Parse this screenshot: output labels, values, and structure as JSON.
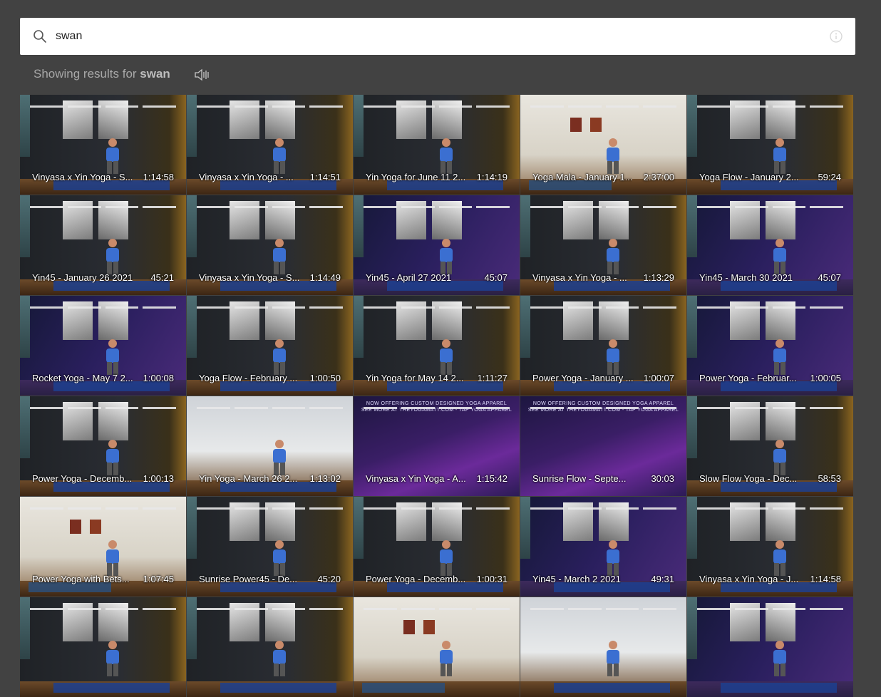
{
  "search": {
    "value": "swan",
    "placeholder": ""
  },
  "results": {
    "prefix": "Showing results for ",
    "query": "swan"
  },
  "icons": {
    "search": "search-icon",
    "info": "info-icon",
    "speaker": "speaker-icon"
  },
  "videos": [
    {
      "title": "Vinyasa x Yin Yoga - S...",
      "duration": "1:14:58",
      "style": "studio"
    },
    {
      "title": "Vinyasa x Yin Yoga - ...",
      "duration": "1:14:51",
      "style": "studio"
    },
    {
      "title": "Yin Yoga for June 11 2...",
      "duration": "1:14:19",
      "style": "studio"
    },
    {
      "title": "Yoga Mala - January 1...",
      "duration": "2:37:00",
      "style": "room"
    },
    {
      "title": "Yoga Flow - January 2...",
      "duration": "59:24",
      "style": "studio"
    },
    {
      "title": "Yin45 - January 26 2021",
      "duration": "45:21",
      "style": "studio"
    },
    {
      "title": "Vinyasa x Yin Yoga - S...",
      "duration": "1:14:49",
      "style": "studio"
    },
    {
      "title": "Yin45 - April 27 2021",
      "duration": "45:07",
      "style": "purple"
    },
    {
      "title": "Vinyasa x Yin Yoga - ...",
      "duration": "1:13:29",
      "style": "studio"
    },
    {
      "title": "Yin45 - March 30 2021",
      "duration": "45:07",
      "style": "purple"
    },
    {
      "title": "Rocket Yoga - May 7 2...",
      "duration": "1:00:08",
      "style": "purple"
    },
    {
      "title": "Yoga Flow - February ...",
      "duration": "1:00:50",
      "style": "studio"
    },
    {
      "title": "Yin Yoga for May 14 2...",
      "duration": "1:11:27",
      "style": "studio"
    },
    {
      "title": "Power Yoga - January ...",
      "duration": "1:00:07",
      "style": "studio"
    },
    {
      "title": "Power Yoga - Februar...",
      "duration": "1:00:05",
      "style": "purple"
    },
    {
      "title": "Power Yoga - Decemb...",
      "duration": "1:00:13",
      "style": "studio"
    },
    {
      "title": "Yin Yoga - March 26 2...",
      "duration": "1:13:02",
      "style": "white"
    },
    {
      "title": "Vinyasa x Yin Yoga - A...",
      "duration": "1:15:42",
      "style": "promo"
    },
    {
      "title": "Sunrise Flow - Septe...",
      "duration": "30:03",
      "style": "promo"
    },
    {
      "title": "Slow Flow Yoga - Dec...",
      "duration": "58:53",
      "style": "studio"
    },
    {
      "title": "Power Yoga with Bets...",
      "duration": "1:07:45",
      "style": "room"
    },
    {
      "title": "Sunrise Power45 - De...",
      "duration": "45:20",
      "style": "studio"
    },
    {
      "title": "Power Yoga - Decemb...",
      "duration": "1:00:31",
      "style": "studio"
    },
    {
      "title": "Yin45 - March 2 2021",
      "duration": "49:31",
      "style": "purple"
    },
    {
      "title": "Vinyasa x Yin Yoga - J...",
      "duration": "1:14:58",
      "style": "studio"
    },
    {
      "title": "",
      "duration": "",
      "style": "studio"
    },
    {
      "title": "",
      "duration": "",
      "style": "studio"
    },
    {
      "title": "",
      "duration": "",
      "style": "room"
    },
    {
      "title": "",
      "duration": "",
      "style": "white"
    },
    {
      "title": "",
      "duration": "",
      "style": "purple"
    }
  ],
  "promo": {
    "line1": "NOW OFFERING CUSTOM DESIGNED YOGA APPAREL",
    "line2": "SEE MORE AT THEYOGAMATT.COM - TAP YOGA APPAREL"
  },
  "colors": {
    "background": "#424242",
    "search_bg": "#ffffff",
    "result_text": "#a8a8a8"
  }
}
